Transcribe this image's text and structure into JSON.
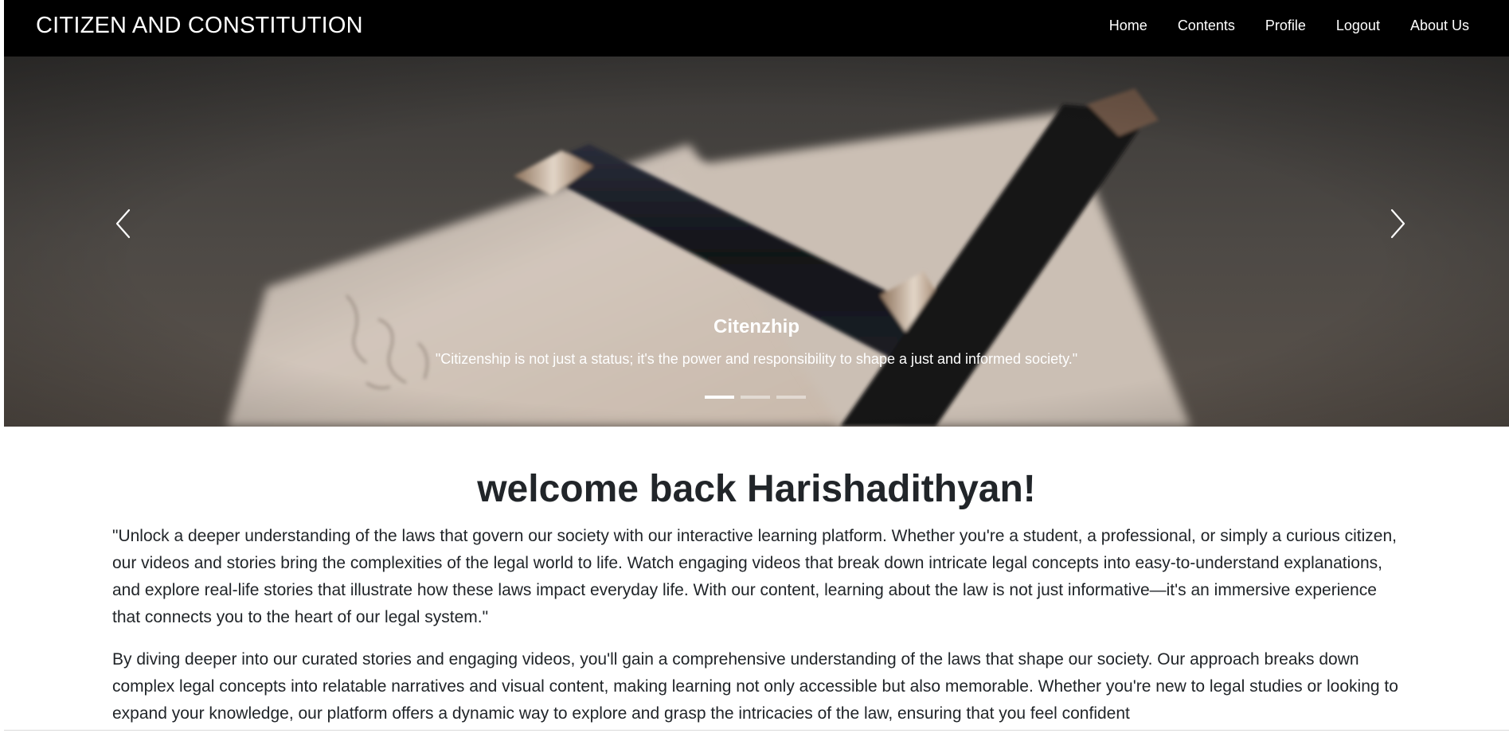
{
  "navbar": {
    "brand": "CITIZEN AND CONSTITUTION",
    "links": [
      "Home",
      "Contents",
      "Profile",
      "Logout",
      "About Us"
    ]
  },
  "carousel": {
    "slide_title": "Citenzhip",
    "slide_text": "\"Citizenship is not just a status; it's the power and responsibility to shape a just and informed society.\"",
    "slide_count": 3,
    "active_slide": 1
  },
  "main": {
    "welcome": "welcome back Harishadithyan!",
    "paragraph1": "\"Unlock a deeper understanding of the laws that govern our society with our interactive learning platform. Whether you're a student, a professional, or simply a curious citizen, our videos and stories bring the complexities of the legal world to life. Watch engaging videos that break down intricate legal concepts into easy-to-understand explanations, and explore real-life stories that illustrate how these laws impact everyday life. With our content, learning about the law is not just informative—it's an immersive experience that connects you to the heart of our legal system.\"",
    "paragraph2": "By diving deeper into our curated stories and engaging videos, you'll gain a comprehensive understanding of the laws that shape our society. Our approach breaks down complex legal concepts into relatable narratives and visual content, making learning not only accessible but also memorable. Whether you're new to legal studies or looking to expand your knowledge, our platform offers a dynamic way to explore and grasp the intricacies of the law, ensuring that you feel confident"
  },
  "colors": {
    "navbar_bg": "#000000",
    "text": "#212529",
    "caption_text": "#ffffff"
  },
  "icons": {
    "prev": "chevron-left-icon",
    "next": "chevron-right-icon"
  }
}
